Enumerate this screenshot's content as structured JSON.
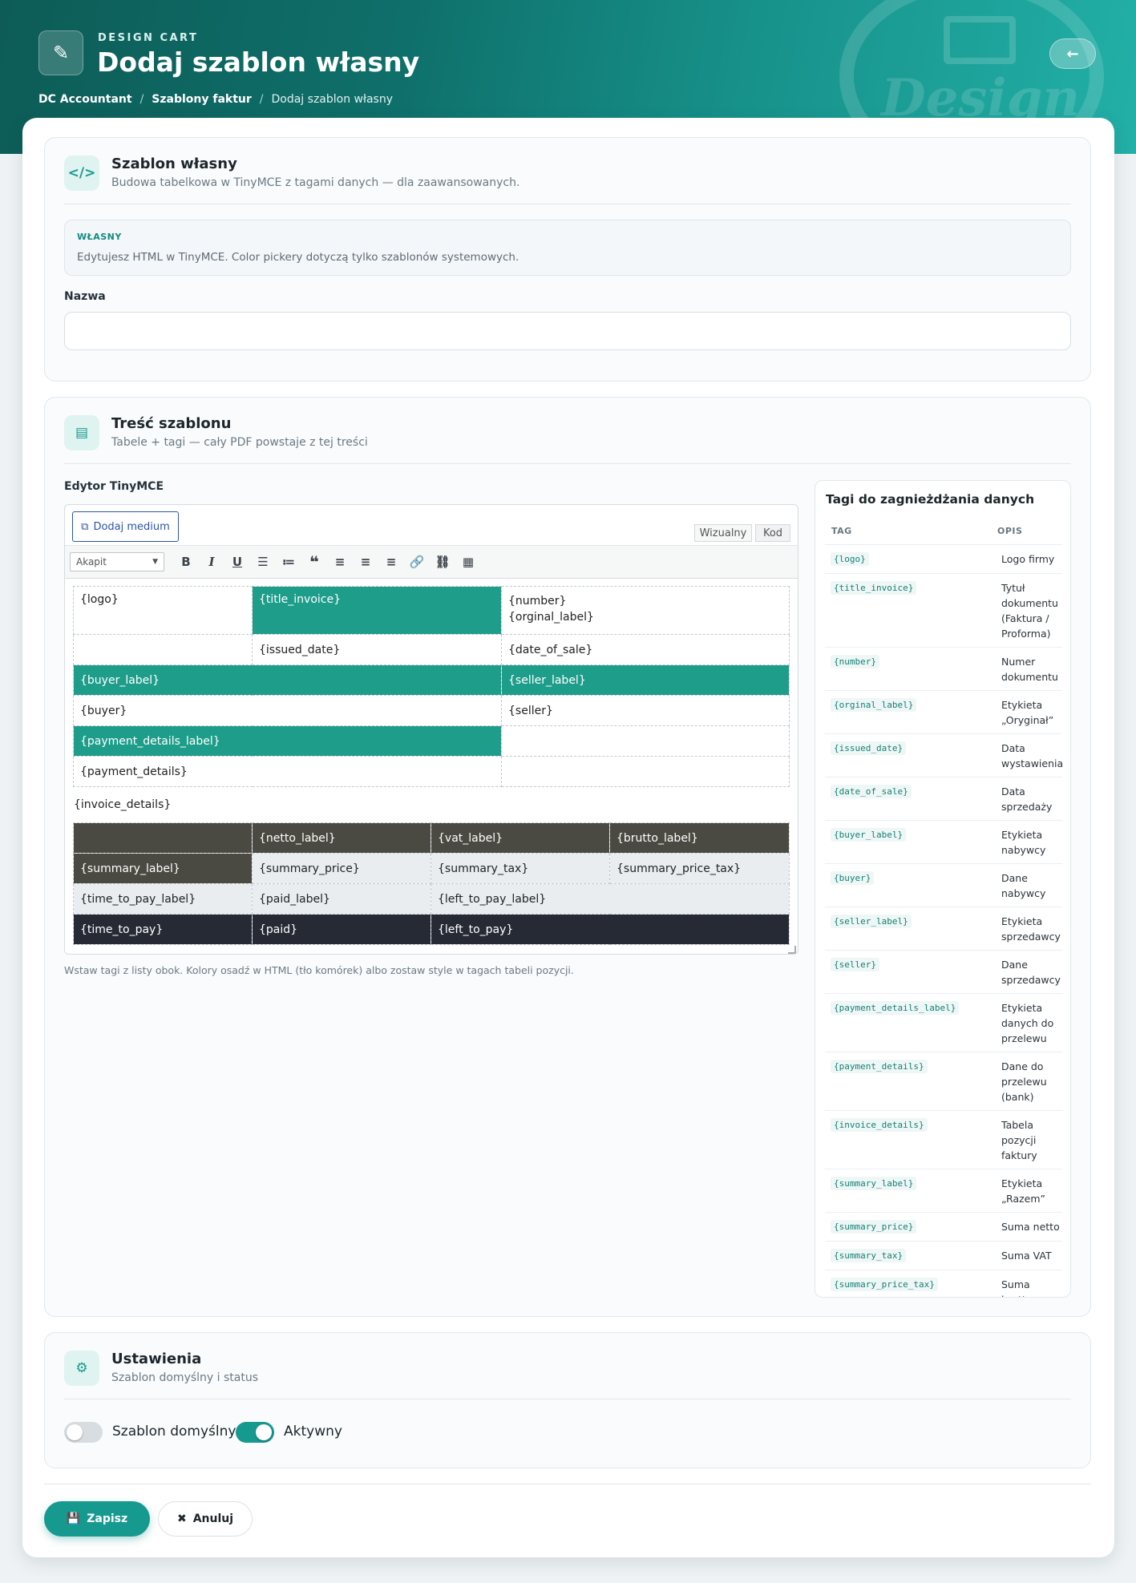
{
  "header": {
    "eyebrow": "DESIGN CART",
    "title": "Dodaj szablon własny",
    "watermark": "Design",
    "breadcrumb": [
      {
        "label": "DC Accountant"
      },
      {
        "label": "Szablony faktur"
      },
      {
        "label": "Dodaj szablon własny"
      }
    ],
    "back_icon": "arrow-left-icon"
  },
  "template_section": {
    "title": "Szablon własny",
    "subtitle": "Budowa tabelkowa w TinyMCE z tagami danych — dla zaawansowanych.",
    "info_tag": "WŁASNY",
    "info_text": "Edytujesz HTML w TinyMCE. Color pickery dotyczą tylko szablonów systemowych.",
    "name_label": "Nazwa",
    "name_value": ""
  },
  "content_section": {
    "title": "Treść szablonu",
    "subtitle": "Tabele + tagi — cały PDF powstaje z tej treści",
    "editor_label": "Edytor TinyMCE",
    "add_media": "Dodaj medium",
    "tab_visual": "Wizualny",
    "tab_code": "Kod",
    "format_value": "Akapit",
    "hint": "Wstaw tagi z listy obok. Kolory osadź w HTML (tło komórek) albo zostaw style w tagach tabeli pozycji.",
    "canvas": {
      "logo": "{logo}",
      "title_invoice": "{title_invoice}",
      "number": "{number}",
      "orginal_label": "{orginal_label}",
      "issued_date": "{issued_date}",
      "date_of_sale": "{date_of_sale}",
      "buyer_label": "{buyer_label}",
      "seller_label": "{seller_label}",
      "buyer": "{buyer}",
      "seller": "{seller}",
      "payment_details_label": "{payment_details_label}",
      "payment_details": "{payment_details}",
      "invoice_details": "{invoice_details}",
      "netto_label": "{netto_label}",
      "vat_label": "{vat_label}",
      "brutto_label": "{brutto_label}",
      "summary_label": "{summary_label}",
      "summary_price": "{summary_price}",
      "summary_tax": "{summary_tax}",
      "summary_price_tax": "{summary_price_tax}",
      "time_to_pay_label": "{time_to_pay_label}",
      "paid_label": "{paid_label}",
      "left_to_pay_label": "{left_to_pay_label}",
      "time_to_pay": "{time_to_pay}",
      "paid": "{paid}",
      "left_to_pay": "{left_to_pay}"
    }
  },
  "tags_panel": {
    "title": "Tagi do zagnieżdżania danych",
    "col_tag": "TAG",
    "col_desc": "OPIS",
    "rows": [
      {
        "tag": "{logo}",
        "desc": "Logo firmy"
      },
      {
        "tag": "{title_invoice}",
        "desc": "Tytuł dokumentu (Faktura / Proforma)"
      },
      {
        "tag": "{number}",
        "desc": "Numer dokumentu"
      },
      {
        "tag": "{orginal_label}",
        "desc": "Etykieta „Oryginał”"
      },
      {
        "tag": "{issued_date}",
        "desc": "Data wystawienia"
      },
      {
        "tag": "{date_of_sale}",
        "desc": "Data sprzedaży"
      },
      {
        "tag": "{buyer_label}",
        "desc": "Etykieta nabywcy"
      },
      {
        "tag": "{buyer}",
        "desc": "Dane nabywcy"
      },
      {
        "tag": "{seller_label}",
        "desc": "Etykieta sprzedawcy"
      },
      {
        "tag": "{seller}",
        "desc": "Dane sprzedawcy"
      },
      {
        "tag": "{payment_details_label}",
        "desc": "Etykieta danych do przelewu"
      },
      {
        "tag": "{payment_details}",
        "desc": "Dane do przelewu (bank)"
      },
      {
        "tag": "{invoice_details}",
        "desc": "Tabela pozycji faktury"
      },
      {
        "tag": "{summary_label}",
        "desc": "Etykieta „Razem”"
      },
      {
        "tag": "{summary_price}",
        "desc": "Suma netto"
      },
      {
        "tag": "{summary_tax}",
        "desc": "Suma VAT"
      },
      {
        "tag": "{summary_price_tax}",
        "desc": "Suma brutto"
      }
    ]
  },
  "settings_section": {
    "title": "Ustawienia",
    "subtitle": "Szablon domyślny i status",
    "default_label": "Szablon domyślny",
    "default_on": false,
    "active_label": "Aktywny",
    "active_on": true
  },
  "actions": {
    "save": "Zapisz",
    "cancel": "Anuluj"
  },
  "colors": {
    "accent": "#16998f",
    "cell_teal": "#1f9d8b",
    "cell_dark": "#4a4a42",
    "cell_navy": "#252a34",
    "cell_light": "#e9edf0"
  }
}
